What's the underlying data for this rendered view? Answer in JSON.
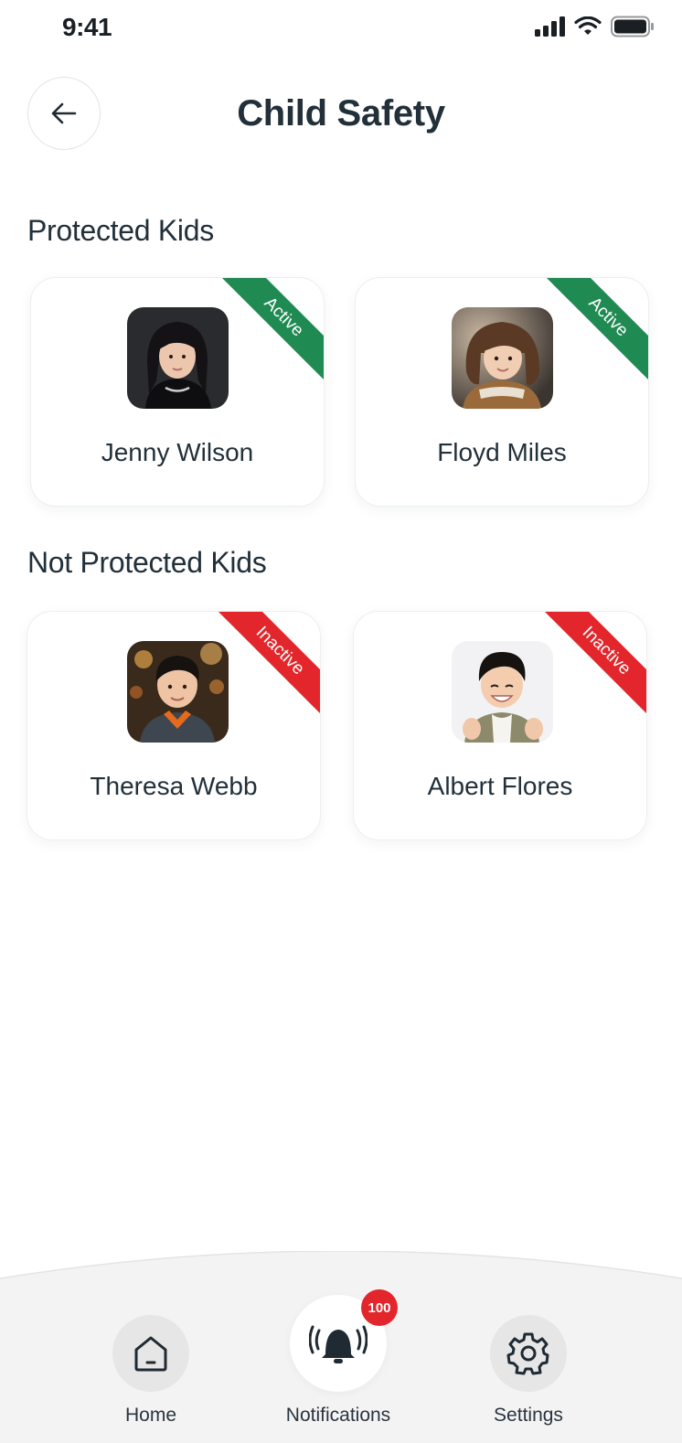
{
  "status_bar": {
    "time": "9:41"
  },
  "header": {
    "title": "Child Safety"
  },
  "sections": {
    "protected": {
      "title": "Protected Kids",
      "kids": [
        {
          "name": "Jenny Wilson",
          "status": "Active"
        },
        {
          "name": "Floyd Miles",
          "status": "Active"
        }
      ]
    },
    "unprotected": {
      "title": "Not Protected Kids",
      "kids": [
        {
          "name": "Theresa Webb",
          "status": "Inactive"
        },
        {
          "name": "Albert Flores",
          "status": "Inactive"
        }
      ]
    }
  },
  "nav": {
    "home": {
      "label": "Home",
      "icon": "home-icon"
    },
    "notifications": {
      "label": "Notifications",
      "icon": "bell-icon",
      "badge": "100"
    },
    "settings": {
      "label": "Settings",
      "icon": "gear-icon"
    }
  },
  "colors": {
    "active": "#1f8a52",
    "inactive": "#e2262b",
    "text": "#22303a",
    "nav_background": "#f3f3f3"
  }
}
